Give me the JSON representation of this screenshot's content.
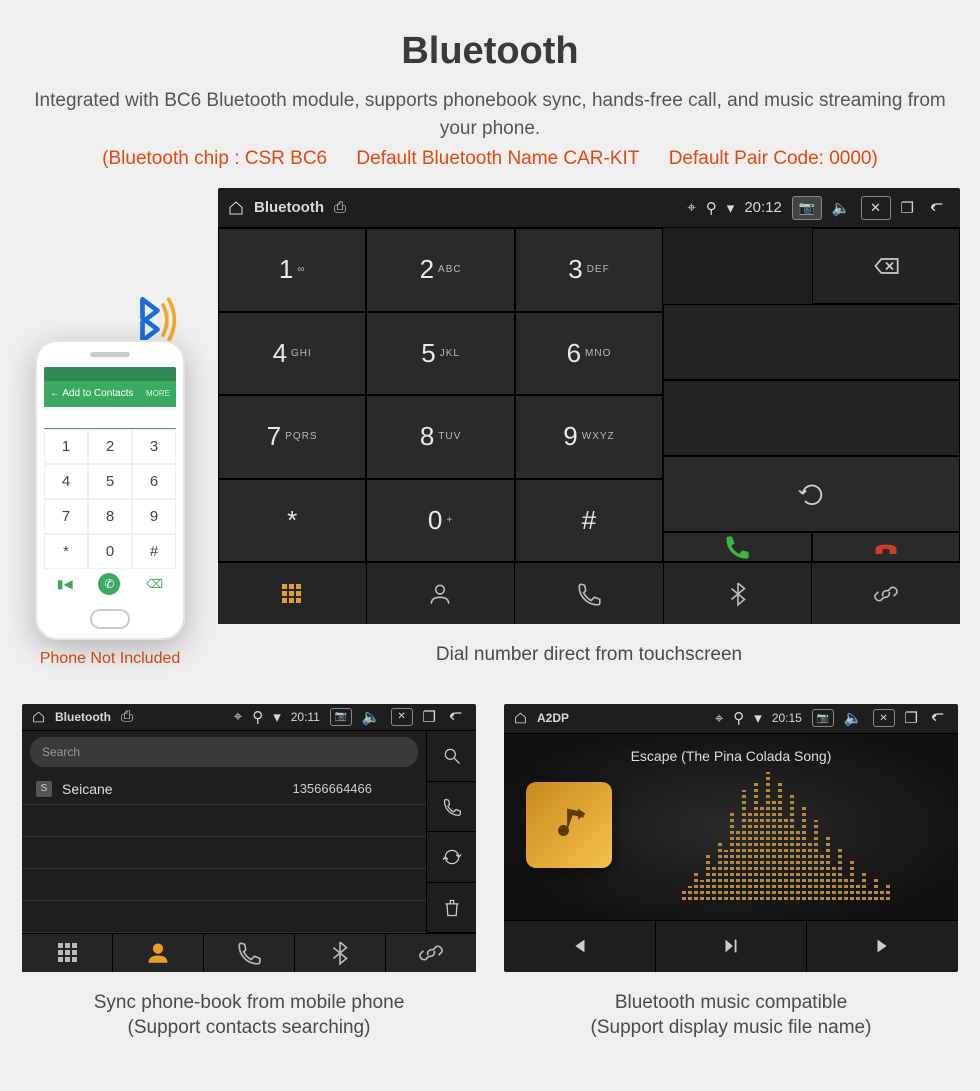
{
  "header": {
    "title": "Bluetooth",
    "subtitle": "Integrated with BC6 Bluetooth module, supports phonebook sync, hands-free call, and music streaming from your phone.",
    "spec_chip": "(Bluetooth chip : CSR BC6",
    "spec_name": "Default Bluetooth Name CAR-KIT",
    "spec_code": "Default Pair Code: 0000)"
  },
  "phone_mock": {
    "bar_label": "Add to Contacts",
    "bar_more": "MORE",
    "keys": [
      "1",
      "2",
      "3",
      "4",
      "5",
      "6",
      "7",
      "8",
      "9",
      "*",
      "0",
      "#"
    ],
    "caption": "Phone Not Included"
  },
  "dialpad": {
    "status_title": "Bluetooth",
    "time": "20:12",
    "keys": [
      {
        "n": "1",
        "s": "∞"
      },
      {
        "n": "2",
        "s": "ABC"
      },
      {
        "n": "3",
        "s": "DEF"
      },
      {
        "n": "4",
        "s": "GHI"
      },
      {
        "n": "5",
        "s": "JKL"
      },
      {
        "n": "6",
        "s": "MNO"
      },
      {
        "n": "7",
        "s": "PQRS"
      },
      {
        "n": "8",
        "s": "TUV"
      },
      {
        "n": "9",
        "s": "WXYZ"
      },
      {
        "n": "*",
        "s": ""
      },
      {
        "n": "0",
        "s": "+"
      },
      {
        "n": "#",
        "s": ""
      }
    ],
    "caption": "Dial number direct from touchscreen"
  },
  "phonebook": {
    "status_title": "Bluetooth",
    "time": "20:11",
    "search_placeholder": "Search",
    "contact_badge": "S",
    "contact_name": "Seicane",
    "contact_number": "13566664466",
    "caption_l1": "Sync phone-book from mobile phone",
    "caption_l2": "(Support contacts searching)"
  },
  "a2dp": {
    "status_title": "A2DP",
    "time": "20:15",
    "track": "Escape (The Pina Colada Song)",
    "caption_l1": "Bluetooth music compatible",
    "caption_l2": "(Support display music file name)"
  },
  "eq_heights": [
    10,
    14,
    28,
    20,
    46,
    34,
    60,
    50,
    90,
    70,
    110,
    88,
    120,
    96,
    128,
    100,
    118,
    84,
    106,
    72,
    94,
    60,
    80,
    48,
    66,
    36,
    52,
    24,
    40,
    18,
    30,
    12,
    22,
    10,
    16
  ]
}
